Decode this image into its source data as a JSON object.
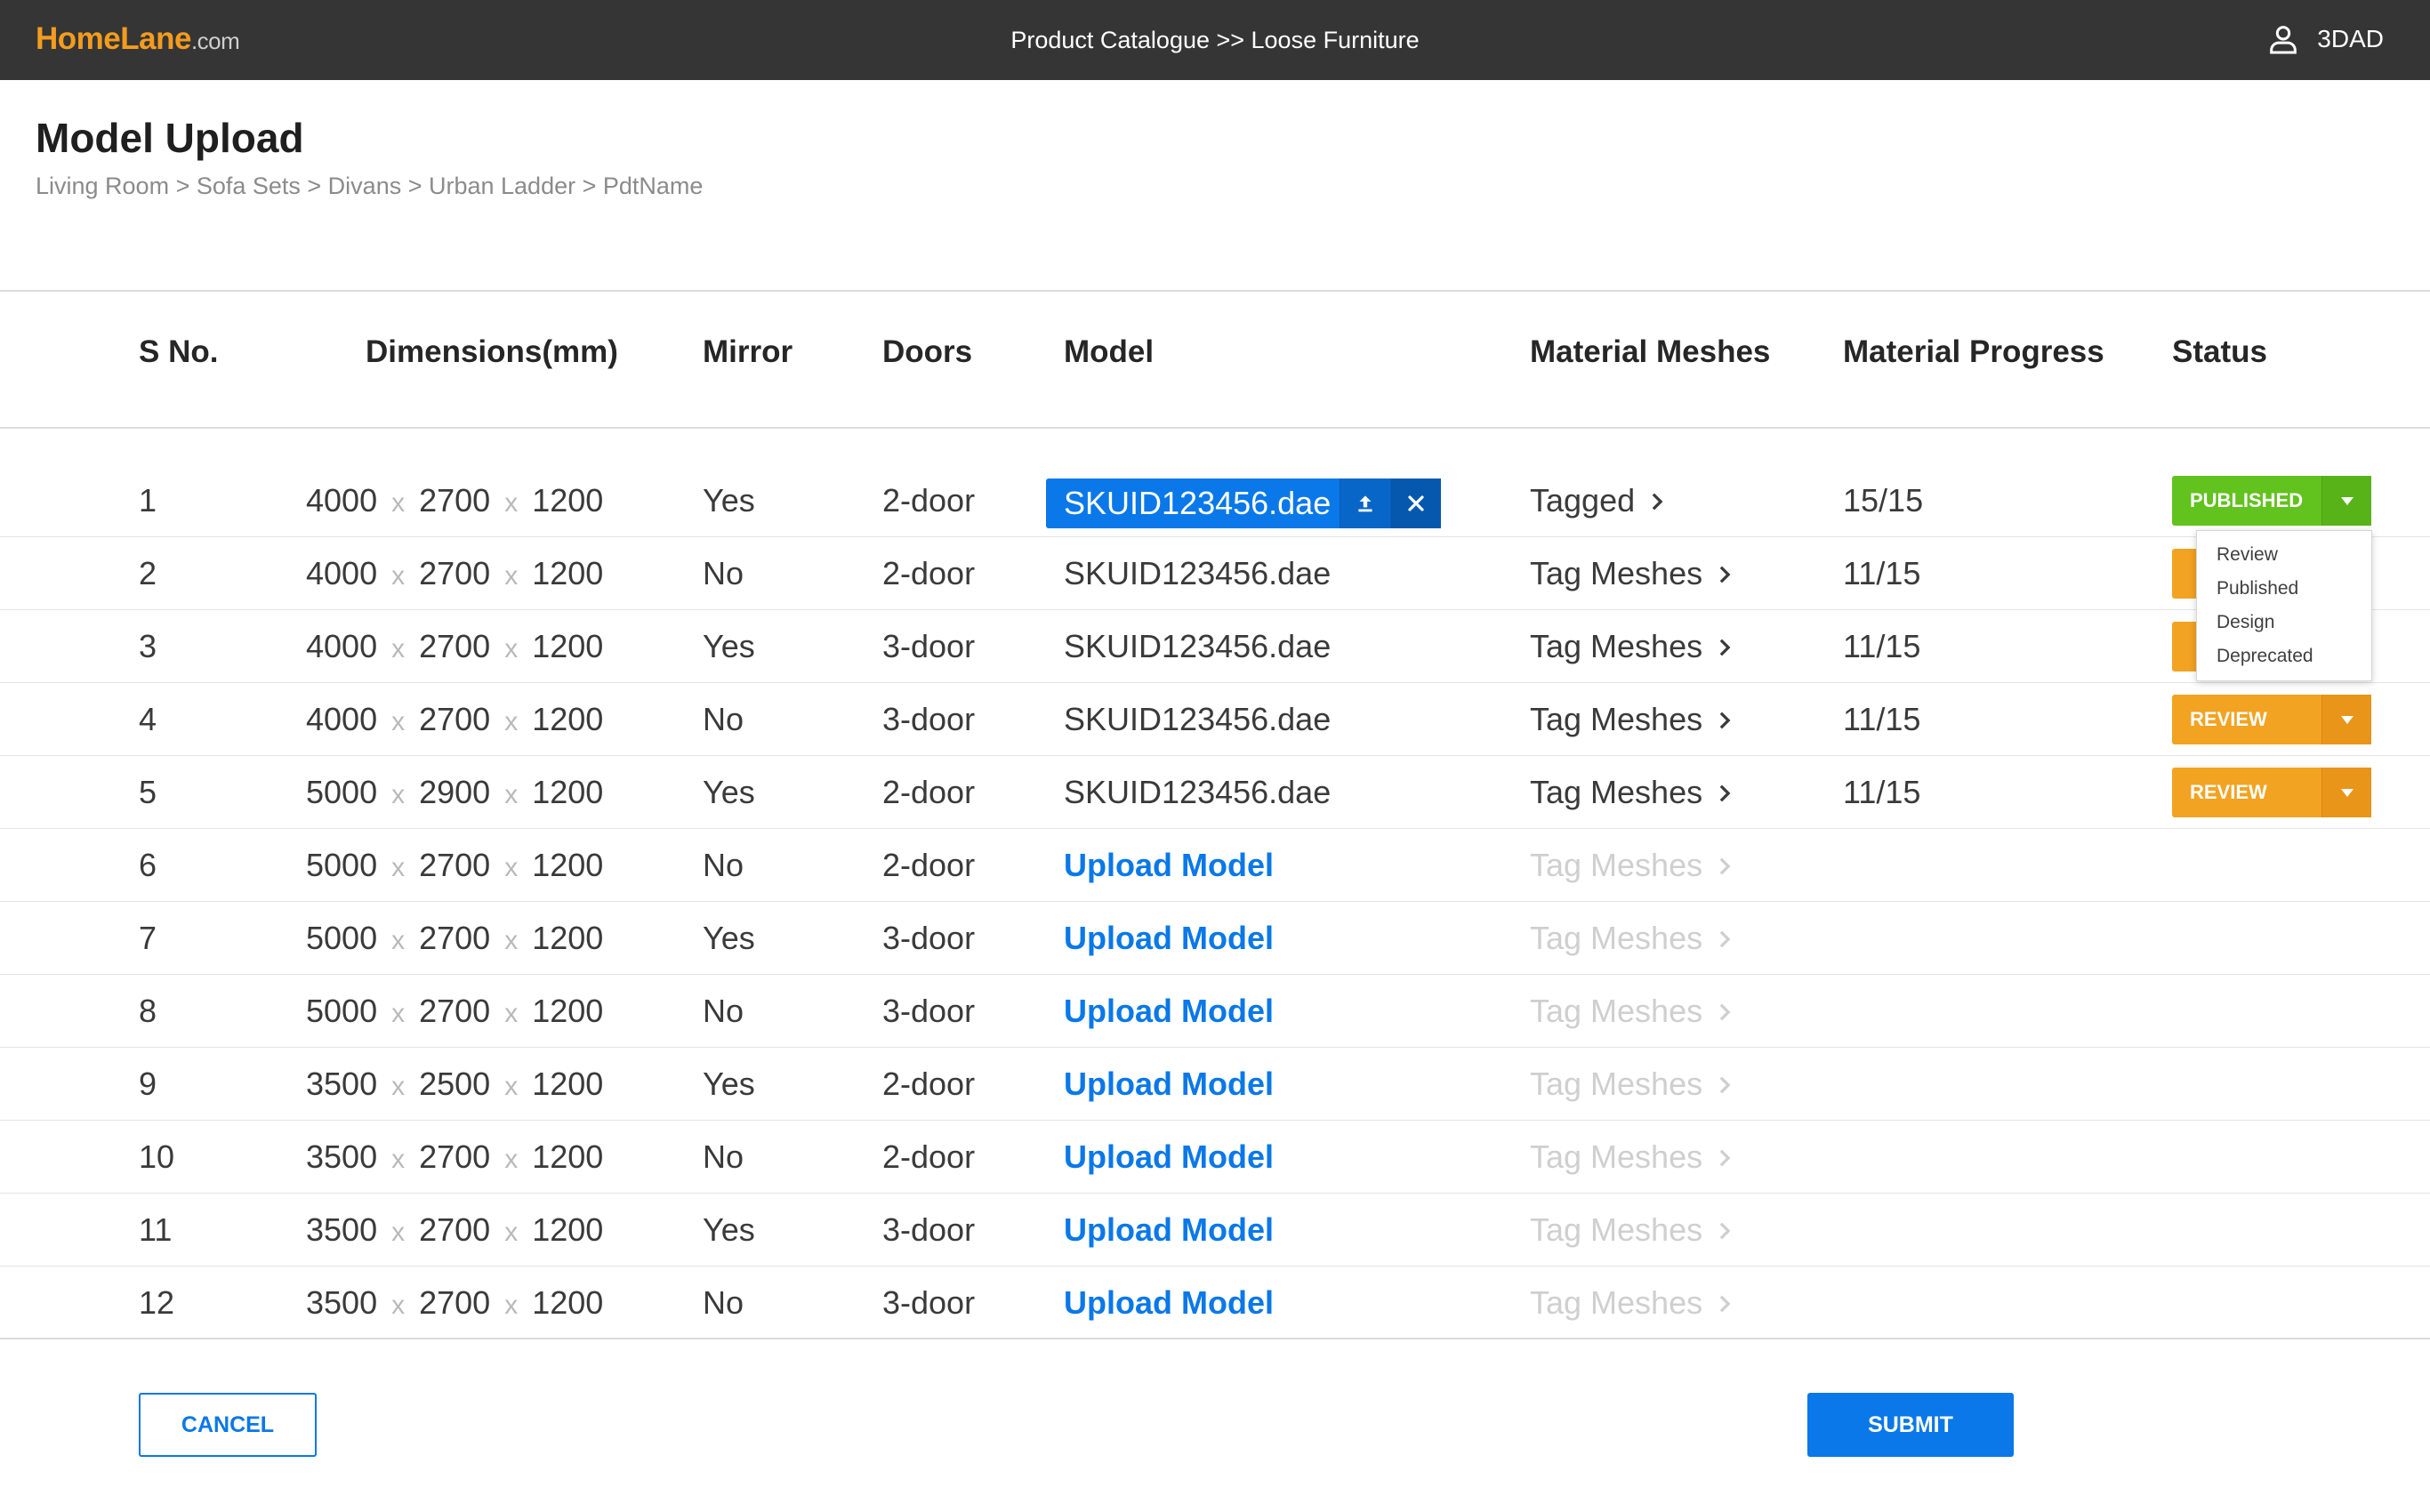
{
  "header": {
    "logo": {
      "brand": "HomeLane",
      "domain": ".com"
    },
    "title": "Product Catalogue >> Loose Furniture",
    "user": "3DAD",
    "user_icon": "user-icon"
  },
  "page": {
    "title": "Model Upload",
    "breadcrumb": "Living Room > Sofa Sets > Divans > Urban Ladder > PdtName"
  },
  "table": {
    "columns": {
      "sno": "S No.",
      "dimensions": "Dimensions(mm)",
      "mirror": "Mirror",
      "doors": "Doors",
      "model": "Model",
      "material_meshes": "Material Meshes",
      "material_progress": "Material Progress",
      "status": "Status"
    },
    "separator": "x",
    "rows": [
      {
        "sno": "1",
        "w": "4000",
        "h": "2700",
        "d": "1200",
        "mirror": "Yes",
        "doors": "2-door",
        "model": "SKUID123456.dae",
        "meshes": "Tagged",
        "progress": "15/15",
        "status": "PUBLISHED"
      },
      {
        "sno": "2",
        "w": "4000",
        "h": "2700",
        "d": "1200",
        "mirror": "No",
        "doors": "2-door",
        "model": "SKUID123456.dae",
        "meshes": "Tag Meshes",
        "progress": "11/15",
        "status": ""
      },
      {
        "sno": "3",
        "w": "4000",
        "h": "2700",
        "d": "1200",
        "mirror": "Yes",
        "doors": "3-door",
        "model": "SKUID123456.dae",
        "meshes": "Tag Meshes",
        "progress": "11/15",
        "status": ""
      },
      {
        "sno": "4",
        "w": "4000",
        "h": "2700",
        "d": "1200",
        "mirror": "No",
        "doors": "3-door",
        "model": "SKUID123456.dae",
        "meshes": "Tag Meshes",
        "progress": "11/15",
        "status": "REVIEW"
      },
      {
        "sno": "5",
        "w": "5000",
        "h": "2900",
        "d": "1200",
        "mirror": "Yes",
        "doors": "2-door",
        "model": "SKUID123456.dae",
        "meshes": "Tag Meshes",
        "progress": "11/15",
        "status": "REVIEW"
      },
      {
        "sno": "6",
        "w": "5000",
        "h": "2700",
        "d": "1200",
        "mirror": "No",
        "doors": "2-door",
        "model": "Upload Model",
        "meshes": "Tag Meshes",
        "progress": "",
        "status": ""
      },
      {
        "sno": "7",
        "w": "5000",
        "h": "2700",
        "d": "1200",
        "mirror": "Yes",
        "doors": "3-door",
        "model": "Upload Model",
        "meshes": "Tag Meshes",
        "progress": "",
        "status": ""
      },
      {
        "sno": "8",
        "w": "5000",
        "h": "2700",
        "d": "1200",
        "mirror": "No",
        "doors": "3-door",
        "model": "Upload Model",
        "meshes": "Tag Meshes",
        "progress": "",
        "status": ""
      },
      {
        "sno": "9",
        "w": "3500",
        "h": "2500",
        "d": "1200",
        "mirror": "Yes",
        "doors": "2-door",
        "model": "Upload Model",
        "meshes": "Tag Meshes",
        "progress": "",
        "status": ""
      },
      {
        "sno": "10",
        "w": "3500",
        "h": "2700",
        "d": "1200",
        "mirror": "No",
        "doors": "2-door",
        "model": "Upload Model",
        "meshes": "Tag Meshes",
        "progress": "",
        "status": ""
      },
      {
        "sno": "11",
        "w": "3500",
        "h": "2700",
        "d": "1200",
        "mirror": "Yes",
        "doors": "3-door",
        "model": "Upload Model",
        "meshes": "Tag Meshes",
        "progress": "",
        "status": ""
      },
      {
        "sno": "12",
        "w": "3500",
        "h": "2700",
        "d": "1200",
        "mirror": "No",
        "doors": "3-door",
        "model": "Upload Model",
        "meshes": "Tag Meshes",
        "progress": "",
        "status": ""
      }
    ]
  },
  "status_menu": {
    "options": [
      "Review",
      "Published",
      "Design",
      "Deprecated"
    ]
  },
  "footer": {
    "cancel_label": "CANCEL",
    "submit_label": "SUBMIT"
  },
  "colors": {
    "topbar": "#353535",
    "accent_blue": "#0a78e8",
    "published_green": "#62c21e",
    "review_orange": "#f2a322",
    "logo_orange": "#f39c1f"
  }
}
